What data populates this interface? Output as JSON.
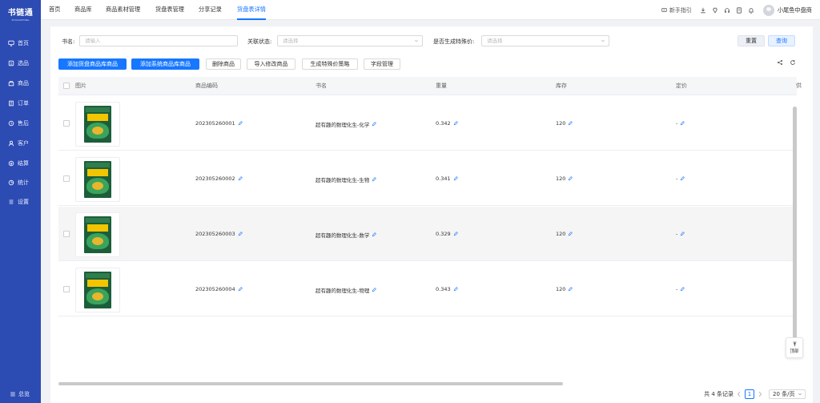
{
  "sidebar": {
    "logo": "书链通",
    "logo_sub": "SHULIANTONG",
    "items": [
      {
        "label": "首页",
        "icon": "monitor-icon"
      },
      {
        "label": "选品",
        "icon": "box-icon"
      },
      {
        "label": "商品",
        "icon": "goods-icon"
      },
      {
        "label": "订单",
        "icon": "order-icon"
      },
      {
        "label": "售后",
        "icon": "service-icon"
      },
      {
        "label": "客户",
        "icon": "customer-icon"
      },
      {
        "label": "结算",
        "icon": "settle-icon"
      },
      {
        "label": "统计",
        "icon": "stats-icon"
      },
      {
        "label": "设置",
        "icon": "settings-icon"
      }
    ],
    "overview": "总览",
    "color": "#2c4bb3"
  },
  "header": {
    "tabs": [
      {
        "label": "首页",
        "active": false
      },
      {
        "label": "商品库",
        "active": false
      },
      {
        "label": "商品素材管理",
        "active": false
      },
      {
        "label": "货盘表管理",
        "active": false
      },
      {
        "label": "分享记录",
        "active": false
      },
      {
        "label": "货盘表详情",
        "active": true
      }
    ],
    "guide": "新手指引",
    "user_name": "小尾鱼中盘商"
  },
  "filters": {
    "book_name_label": "书名:",
    "book_name_placeholder": "请输入",
    "link_status_label": "关联状态:",
    "link_status_placeholder": "请选择",
    "special_price_label": "是否生成特殊价:",
    "special_price_placeholder": "请选择",
    "reset": "重置",
    "query": "查询"
  },
  "toolbar": {
    "add_pallet": "添加货盘商品库商品",
    "add_system": "添加系统商品库商品",
    "delete": "删除商品",
    "import_edit": "导入修改商品",
    "gen_price": "生成特殊价策略",
    "field_manage": "字段管理"
  },
  "table": {
    "columns": [
      "图片",
      "商品编码",
      "书名",
      "重量",
      "库存",
      "定价",
      "供"
    ],
    "rows": [
      {
        "code": "202305260001",
        "name": "超有趣的数理化生-化学",
        "weight": "0.342",
        "stock": "120",
        "price": "-"
      },
      {
        "code": "202305260002",
        "name": "超有趣的数理化生-生物",
        "weight": "0.341",
        "stock": "120",
        "price": "-"
      },
      {
        "code": "202305260003",
        "name": "超有趣的数理化生-数学",
        "weight": "0.329",
        "stock": "120",
        "price": "-"
      },
      {
        "code": "202305260004",
        "name": "超有趣的数理化生-物理",
        "weight": "0.343",
        "stock": "120",
        "price": "-"
      }
    ]
  },
  "to_top": "顶部",
  "pagination": {
    "total": "共 4 条记录",
    "current": "1",
    "page_size": "20 条/页"
  },
  "colors": {
    "accent": "#1677ff"
  }
}
